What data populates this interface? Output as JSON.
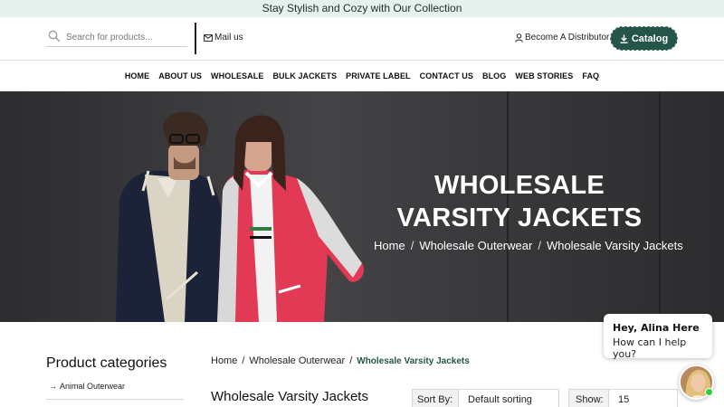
{
  "announcement": "Stay Stylish and Cozy with Our Collection",
  "header": {
    "search_placeholder": "Search for products...",
    "mail_label": "Mail us",
    "distributor_label": "Become A Distributor",
    "catalog_label": "Catalog"
  },
  "nav": {
    "items": [
      "HOME",
      "ABOUT US",
      "WHOLESALE",
      "BULK JACKETS",
      "PRIVATE LABEL",
      "CONTACT US",
      "BLOG",
      "WEB STORIES",
      "FAQ"
    ]
  },
  "hero": {
    "title": "WHOLESALE VARSITY JACKETS",
    "breadcrumb": [
      "Home",
      "Wholesale Outerwear",
      "Wholesale Varsity Jackets"
    ],
    "separator": "/"
  },
  "sidebar": {
    "title": "Product categories",
    "items": [
      "Animal Outerwear"
    ]
  },
  "main": {
    "breadcrumb": [
      "Home",
      "Wholesale Outerwear",
      "Wholesale Varsity Jackets"
    ],
    "separator": "/",
    "page_title": "Wholesale Varsity Jackets",
    "sort_label": "Sort By:",
    "sort_value": "Default sorting",
    "show_label": "Show:",
    "show_value": "15"
  },
  "chat": {
    "greeting": "Hey, Alina Here",
    "message": "How can I help you?"
  },
  "colors": {
    "accent": "#24544a",
    "announce_bg": "#e6f1ee",
    "online": "#2ecc40"
  }
}
